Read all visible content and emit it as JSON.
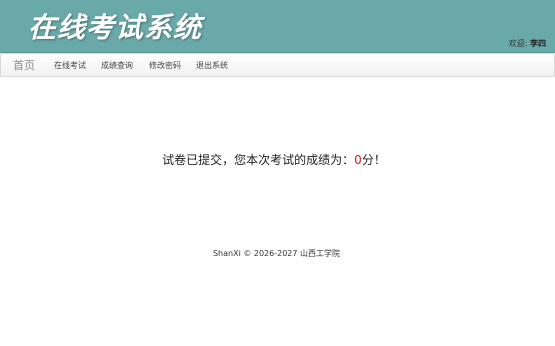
{
  "header": {
    "title": "在线考试系统",
    "welcome_label": "欢迎:",
    "username": "李四"
  },
  "nav": {
    "home": "首页",
    "items": [
      "在线考试",
      "成绩查询",
      "修改密码",
      "退出系统"
    ]
  },
  "result": {
    "prefix": "试卷已提交，您本次考试的成绩为：",
    "score": "0",
    "suffix": "分！"
  },
  "footer": {
    "text": "ShanXi © 2026-2027 山西工学院"
  },
  "colors": {
    "header_bg": "#6aa9a9",
    "score": "#e01818"
  }
}
